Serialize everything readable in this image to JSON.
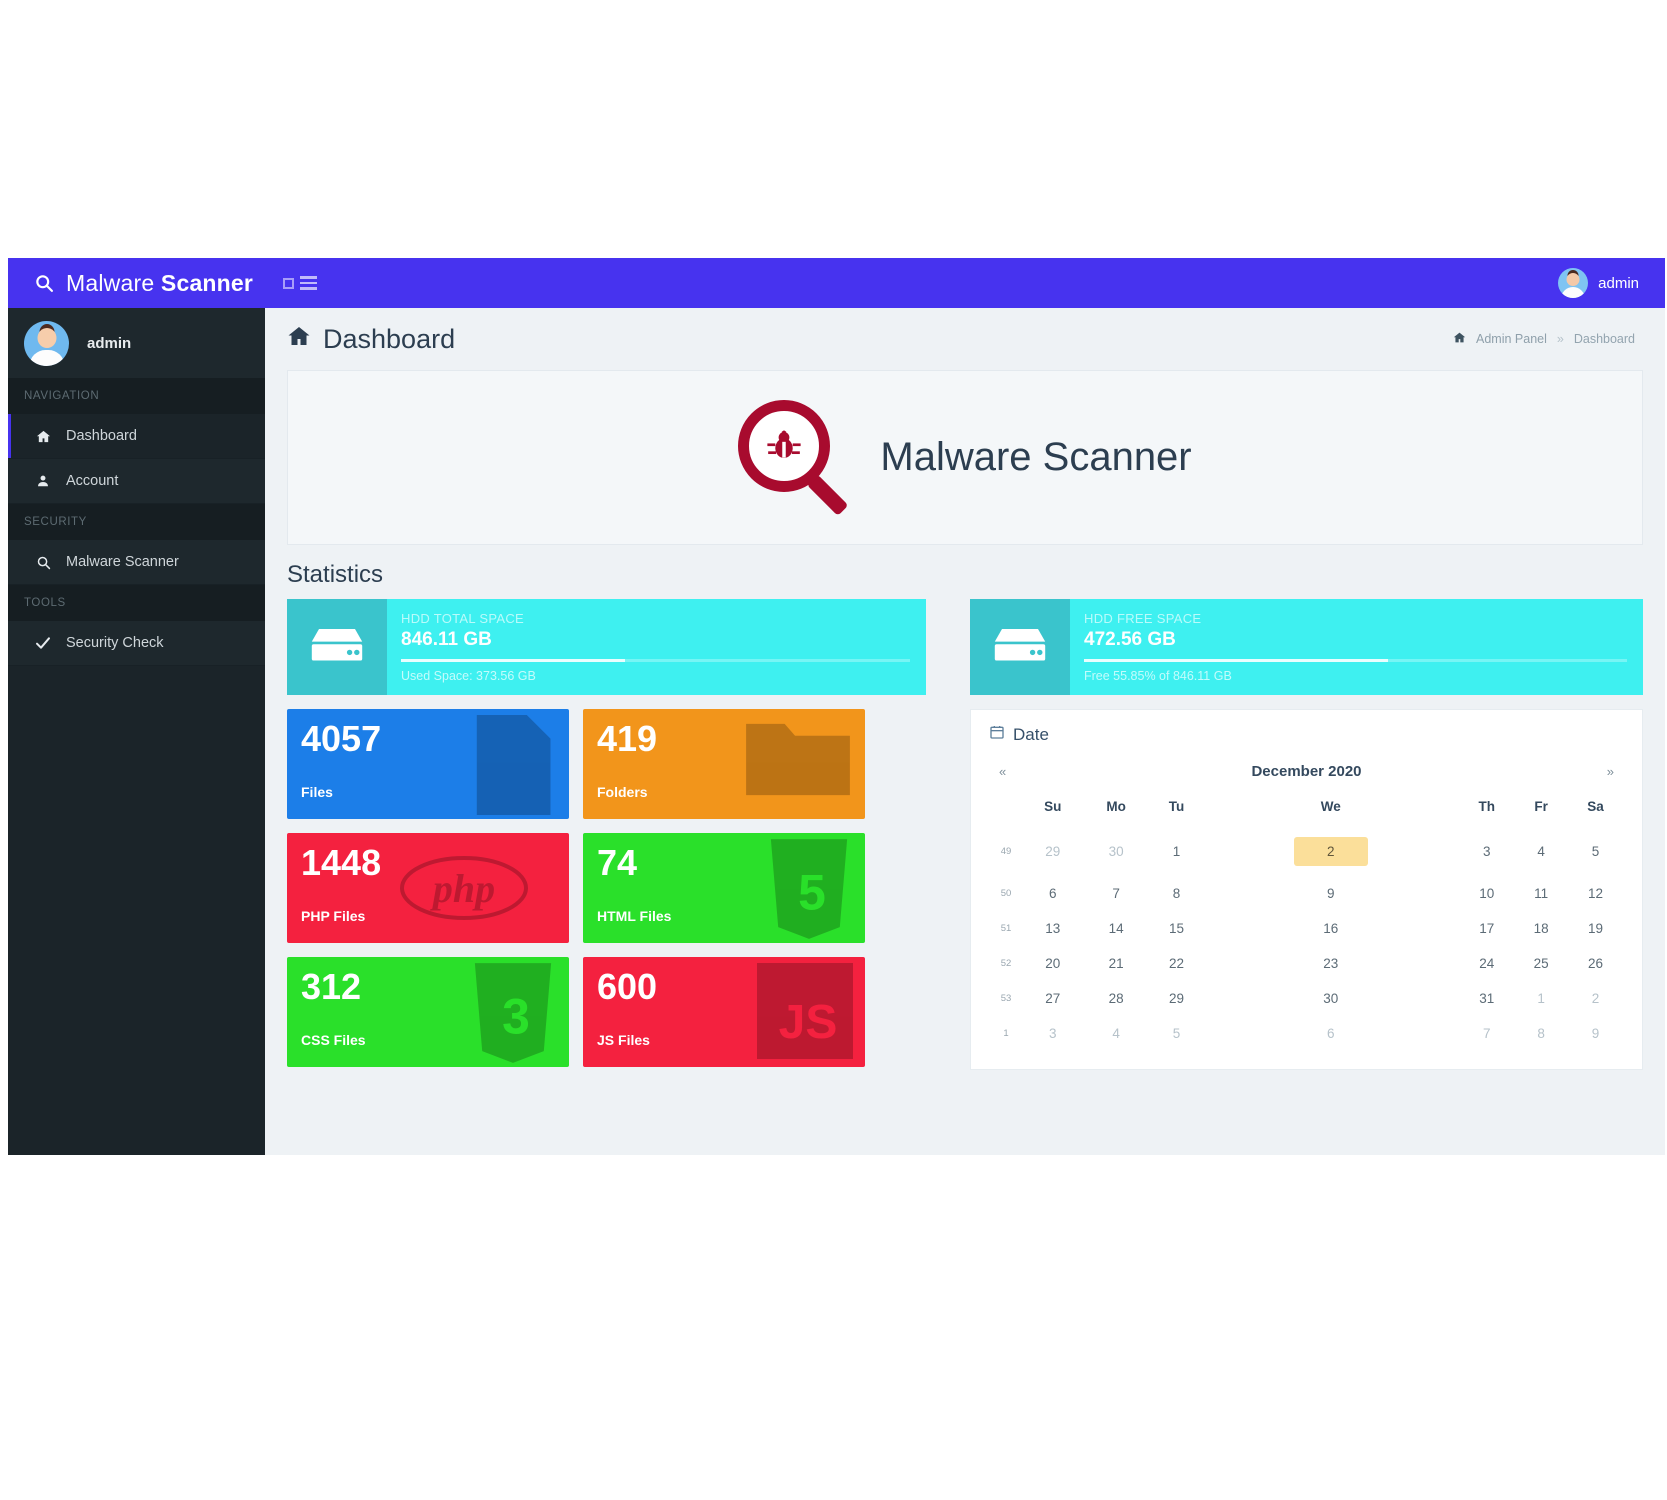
{
  "topbar": {
    "brand_light": "Malware ",
    "brand_bold": "Scanner",
    "search_icon": "search-icon",
    "toggle_icon": "sidebar-toggle-icon",
    "menu_icon": "hamburger-menu-icon",
    "user": "admin"
  },
  "sidebar": {
    "user": "admin",
    "groups": [
      {
        "title": "NAVIGATION",
        "items": [
          {
            "label": "Dashboard",
            "icon": "home-icon",
            "active": true
          },
          {
            "label": "Account",
            "icon": "user-icon",
            "active": false
          }
        ]
      },
      {
        "title": "SECURITY",
        "items": [
          {
            "label": "Malware Scanner",
            "icon": "search-icon",
            "active": false
          }
        ]
      },
      {
        "title": "TOOLS",
        "items": [
          {
            "label": "Security Check",
            "icon": "check-icon",
            "active": false
          }
        ]
      }
    ]
  },
  "page": {
    "title": "Dashboard",
    "title_icon": "home-icon",
    "breadcrumb": {
      "root": "Admin Panel",
      "separator": "»",
      "current": "Dashboard"
    },
    "hero_title": "Malware Scanner",
    "hero_icon": "magnifier-bug-icon",
    "statistics_heading": "Statistics"
  },
  "hdd_cards": [
    {
      "label": "HDD TOTAL SPACE",
      "value": "846.11 GB",
      "sub": "Used Space: 373.56 GB",
      "percent": 44,
      "icon": "hdd-icon",
      "color": "#3ef0f0"
    },
    {
      "label": "HDD FREE SPACE",
      "value": "472.56 GB",
      "sub": "Free 55.85% of 846.11 GB",
      "percent": 56,
      "icon": "hdd-icon",
      "color": "#3ef0f0"
    }
  ],
  "tiles": [
    {
      "number": "4057",
      "label": "Files",
      "color": "#1c7ee8",
      "icon": "file-icon"
    },
    {
      "number": "419",
      "label": "Folders",
      "color": "#f2951b",
      "icon": "folder-icon"
    },
    {
      "number": "1448",
      "label": "PHP Files",
      "color": "#f4213f",
      "icon": "php-icon"
    },
    {
      "number": "74",
      "label": "HTML Files",
      "color": "#2ae02a",
      "icon": "html5-icon"
    },
    {
      "number": "312",
      "label": "CSS Files",
      "color": "#2ae02a",
      "icon": "css3-icon"
    },
    {
      "number": "600",
      "label": "JS Files",
      "color": "#f4213f",
      "icon": "js-icon"
    }
  ],
  "calendar": {
    "panel_title": "Date",
    "panel_icon": "calendar-icon",
    "prev_label": "«",
    "next_label": "»",
    "month": "December 2020",
    "weekday_headers": [
      "Su",
      "Mo",
      "Tu",
      "We",
      "Th",
      "Fr",
      "Sa"
    ],
    "week_numbers": [
      "49",
      "50",
      "51",
      "52",
      "53",
      "1"
    ],
    "weeks": [
      [
        {
          "d": "29",
          "mut": true
        },
        {
          "d": "30",
          "mut": true
        },
        {
          "d": "1"
        },
        {
          "d": "2",
          "today": true
        },
        {
          "d": "3"
        },
        {
          "d": "4"
        },
        {
          "d": "5"
        }
      ],
      [
        {
          "d": "6"
        },
        {
          "d": "7"
        },
        {
          "d": "8"
        },
        {
          "d": "9"
        },
        {
          "d": "10"
        },
        {
          "d": "11"
        },
        {
          "d": "12"
        }
      ],
      [
        {
          "d": "13"
        },
        {
          "d": "14"
        },
        {
          "d": "15"
        },
        {
          "d": "16"
        },
        {
          "d": "17"
        },
        {
          "d": "18"
        },
        {
          "d": "19"
        }
      ],
      [
        {
          "d": "20"
        },
        {
          "d": "21"
        },
        {
          "d": "22"
        },
        {
          "d": "23"
        },
        {
          "d": "24"
        },
        {
          "d": "25"
        },
        {
          "d": "26"
        }
      ],
      [
        {
          "d": "27"
        },
        {
          "d": "28"
        },
        {
          "d": "29"
        },
        {
          "d": "30"
        },
        {
          "d": "31"
        },
        {
          "d": "1",
          "mut": true
        },
        {
          "d": "2",
          "mut": true
        }
      ],
      [
        {
          "d": "3",
          "mut": true
        },
        {
          "d": "4",
          "mut": true
        },
        {
          "d": "5",
          "mut": true
        },
        {
          "d": "6",
          "mut": true
        },
        {
          "d": "7",
          "mut": true
        },
        {
          "d": "8",
          "mut": true
        },
        {
          "d": "9",
          "mut": true
        }
      ]
    ]
  }
}
